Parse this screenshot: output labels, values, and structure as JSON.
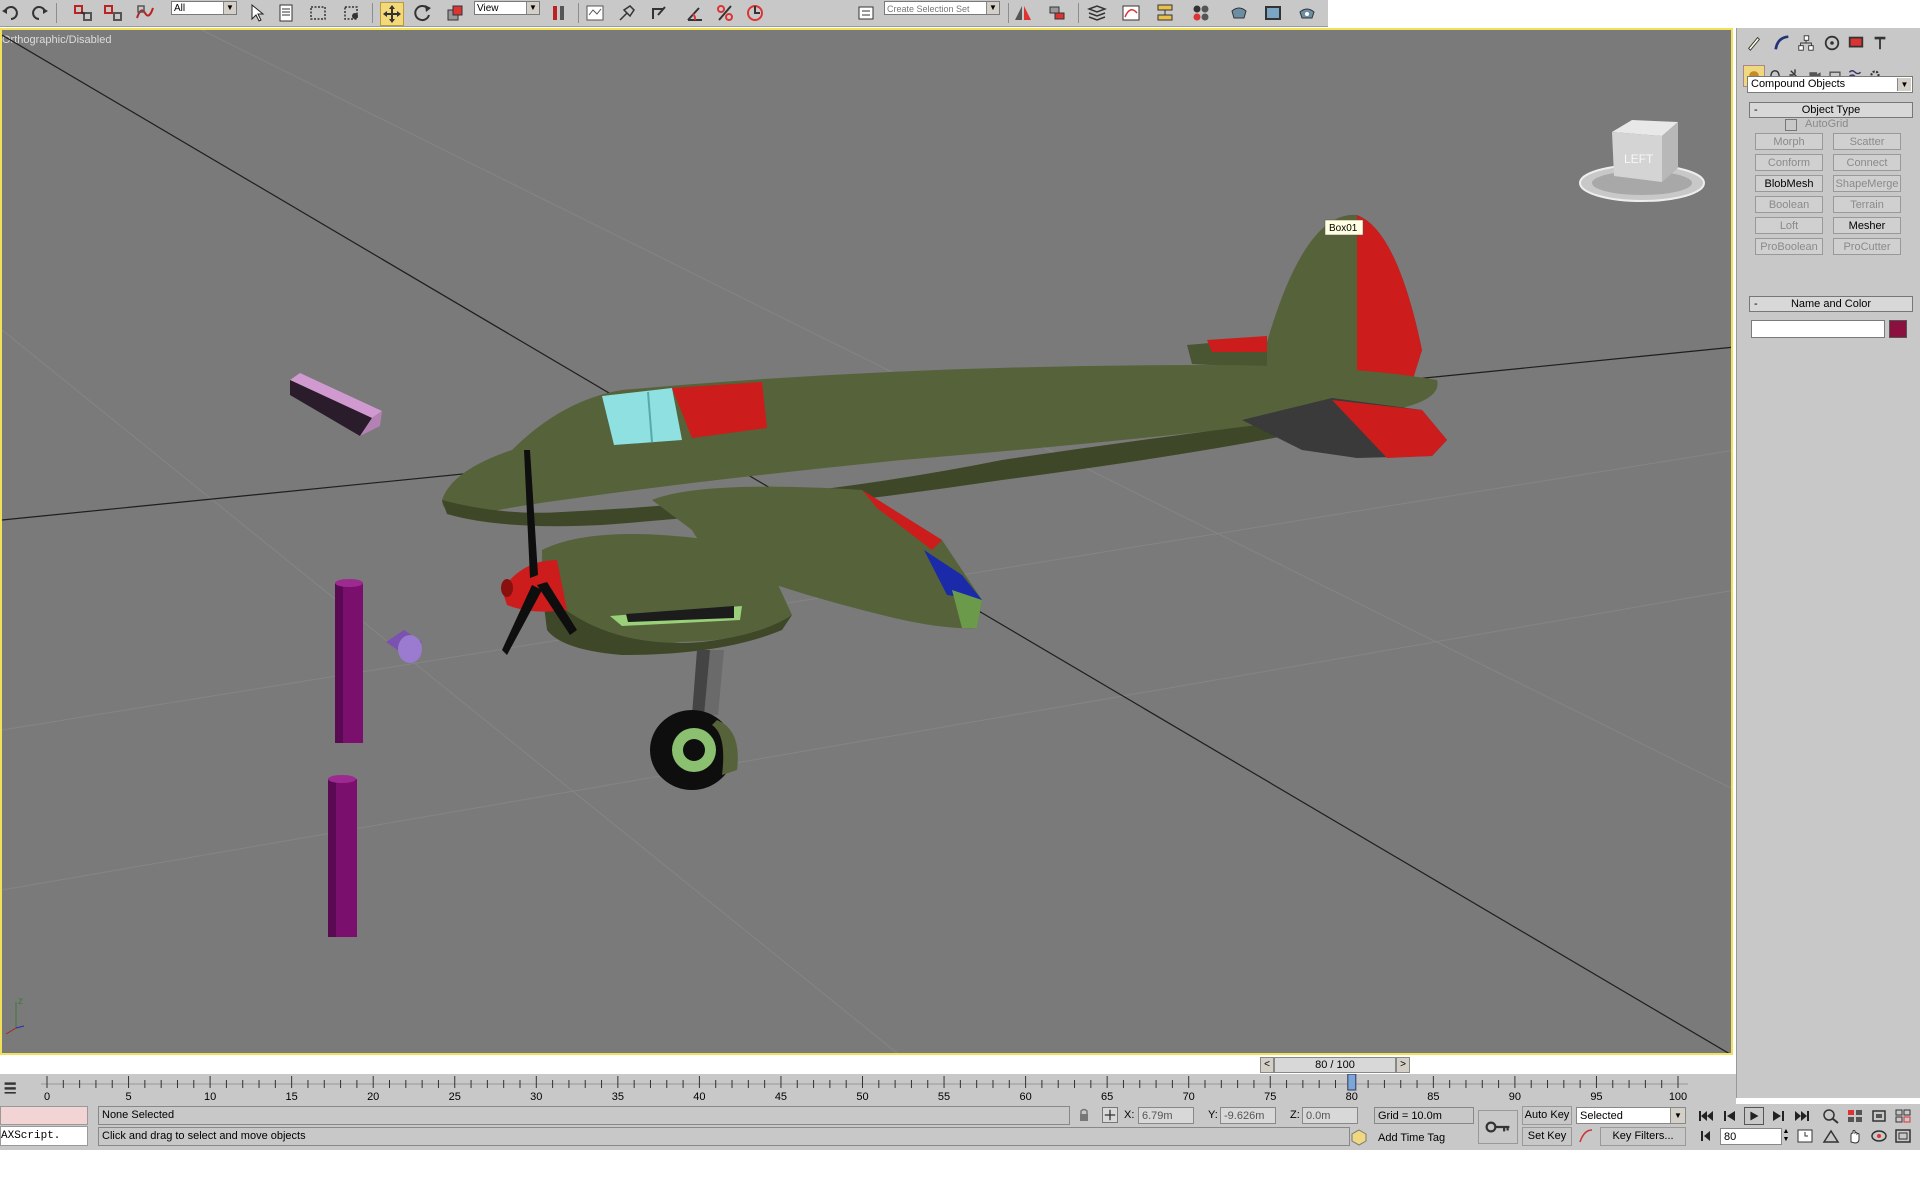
{
  "toolbar": {
    "selection_filter": "All",
    "reference_coord": "View",
    "named_selection_set": "Create Selection Set",
    "icons": [
      "undo-icon",
      "redo-icon",
      "select-link-icon",
      "unlink-icon",
      "bind-space-warp-icon",
      "select-object-icon",
      "select-by-name-icon",
      "rectangular-region-icon",
      "window-crossing-icon",
      "select-move-icon",
      "select-rotate-icon",
      "select-scale-icon",
      "pivot-center-icon",
      "select-manipulate-icon",
      "keyboard-shortcut-icon",
      "snap-toggle-icon",
      "angle-snap-icon",
      "percent-snap-icon",
      "spinner-snap-icon",
      "edit-named-sets-icon",
      "mirror-icon",
      "align-icon",
      "layer-manager-icon",
      "curve-editor-icon",
      "schematic-view-icon",
      "material-editor-icon",
      "render-setup-icon",
      "rendered-frame-icon",
      "render-icon"
    ]
  },
  "viewport": {
    "label": "Orthographic/Disabled",
    "object_tag": "Box01",
    "viewcube_label": "LEFT",
    "axis_label": "z"
  },
  "command_panel": {
    "category_dropdown": "Compound Objects",
    "object_type_title": "Object Type",
    "autogrid_label": "AutoGrid",
    "buttons": [
      {
        "label": "Morph",
        "enabled": false
      },
      {
        "label": "Scatter",
        "enabled": false
      },
      {
        "label": "Conform",
        "enabled": false
      },
      {
        "label": "Connect",
        "enabled": false
      },
      {
        "label": "BlobMesh",
        "enabled": true
      },
      {
        "label": "ShapeMerge",
        "enabled": false
      },
      {
        "label": "Boolean",
        "enabled": false
      },
      {
        "label": "Terrain",
        "enabled": false
      },
      {
        "label": "Loft",
        "enabled": false
      },
      {
        "label": "Mesher",
        "enabled": true
      },
      {
        "label": "ProBoolean",
        "enabled": false
      },
      {
        "label": "ProCutter",
        "enabled": false
      }
    ],
    "name_color_title": "Name and Color",
    "name_value": "",
    "object_color": "#8b1040"
  },
  "timeline": {
    "frame_indicator": "80 / 100",
    "ticks": [
      "0",
      "5",
      "10",
      "15",
      "20",
      "25",
      "30",
      "35",
      "40",
      "45",
      "50",
      "55",
      "60",
      "65",
      "70",
      "75",
      "80",
      "85",
      "90",
      "95",
      "100"
    ],
    "current_frame": 80,
    "max_frame": 100
  },
  "status": {
    "maxscript_label": "AXScript.",
    "selection_status": "None Selected",
    "prompt": "Click and drag to select and move objects",
    "x_label": "X:",
    "x_value": "6.79m",
    "y_label": "Y:",
    "y_value": "-9.626m",
    "z_label": "Z:",
    "z_value": "0.0m",
    "grid": "Grid = 10.0m",
    "add_time_tag": "Add Time Tag",
    "auto_key": "Auto Key",
    "set_key": "Set Key",
    "key_mode": "Selected",
    "key_filters": "Key Filters...",
    "frame_field": "80"
  },
  "colors": {
    "viewport_bg": "#7a7a7a",
    "viewport_border": "#f1e15a",
    "airplane_body": "#56633a",
    "markings_red": "#cc1c1c",
    "primitive_purple": "#7a0f6d"
  }
}
